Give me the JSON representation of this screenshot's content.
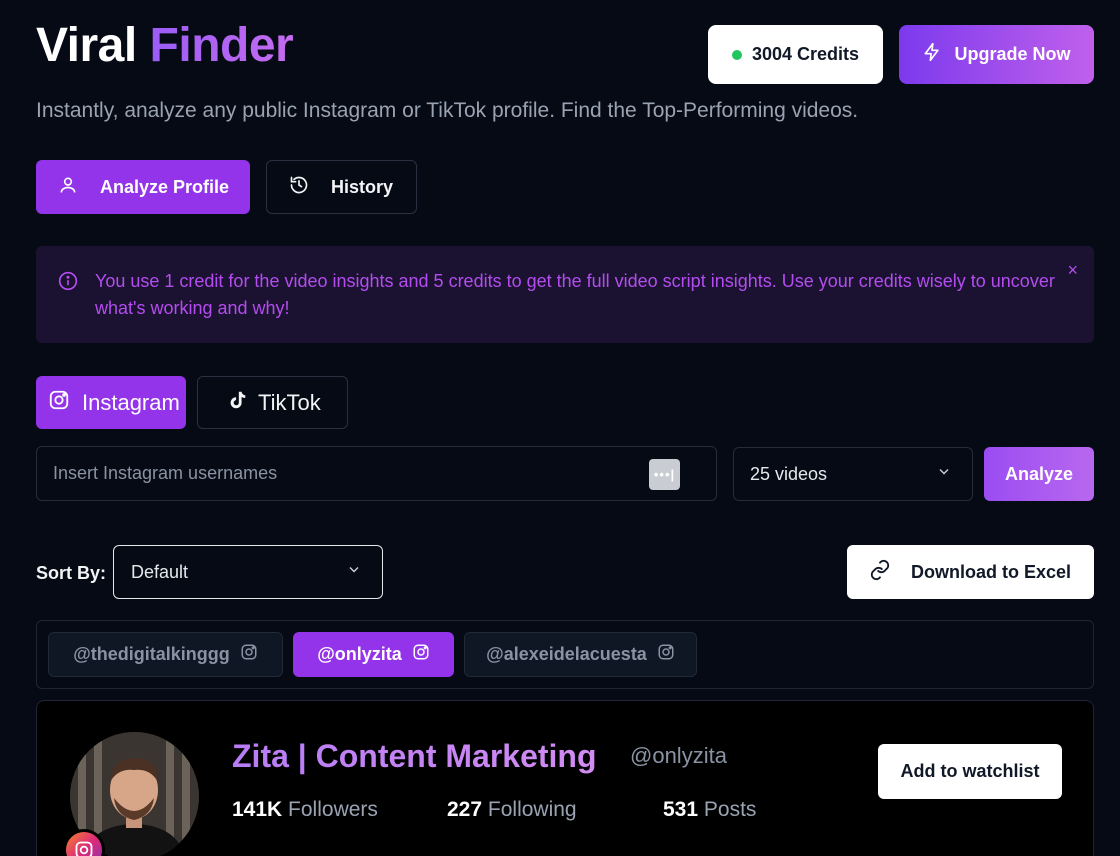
{
  "header": {
    "title_part1": "Viral",
    "title_part2": "Finder",
    "subtitle": "Instantly, analyze any public Instagram or TikTok profile. Find the Top-Performing videos.",
    "credits_label": "3004 Credits",
    "upgrade_label": "Upgrade Now"
  },
  "mode_tabs": {
    "analyze_profile": "Analyze Profile",
    "history": "History"
  },
  "info_banner": {
    "text": "You use 1 credit for the video insights and 5 credits to get the full video script insights. Use your credits wisely to uncover what's working and why!",
    "close": "×"
  },
  "platform_tabs": {
    "instagram": "Instagram",
    "tiktok": "TikTok"
  },
  "search": {
    "placeholder": "Insert Instagram usernames",
    "value": "",
    "video_count": "25 videos",
    "analyze_label": "Analyze"
  },
  "sort": {
    "label": "Sort By:",
    "value": "Default",
    "download_label": "Download to Excel"
  },
  "profiles": [
    {
      "handle": "@thedigitalkinggg",
      "active": false
    },
    {
      "handle": "@onlyzita",
      "active": true
    },
    {
      "handle": "@alexeidelacuesta",
      "active": false
    }
  ],
  "profile_card": {
    "name": "Zita | Content Marketing",
    "handle": "@onlyzita",
    "followers_count": "141K",
    "followers_label": "Followers",
    "following_count": "227",
    "following_label": "Following",
    "posts_count": "531",
    "posts_label": "Posts",
    "watchlist_label": "Add to watchlist"
  },
  "colors": {
    "accent": "#9333ea",
    "background": "#050a14",
    "status_green": "#22c55e"
  }
}
